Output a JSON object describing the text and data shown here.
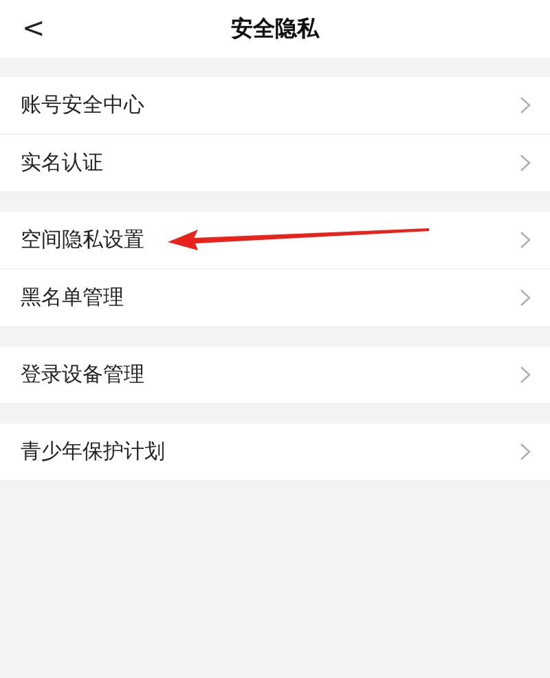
{
  "header": {
    "back": "<",
    "title": "安全隐私"
  },
  "groups": [
    {
      "rows": [
        {
          "label": "账号安全中心",
          "arrow_pointed": false
        },
        {
          "label": "实名认证",
          "arrow_pointed": false
        }
      ]
    },
    {
      "rows": [
        {
          "label": "空间隐私设置",
          "arrow_pointed": true
        },
        {
          "label": "黑名单管理",
          "arrow_pointed": false
        }
      ]
    },
    {
      "rows": [
        {
          "label": "登录设备管理",
          "arrow_pointed": false
        }
      ]
    },
    {
      "rows": [
        {
          "label": "青少年保护计划",
          "arrow_pointed": false
        }
      ]
    }
  ]
}
